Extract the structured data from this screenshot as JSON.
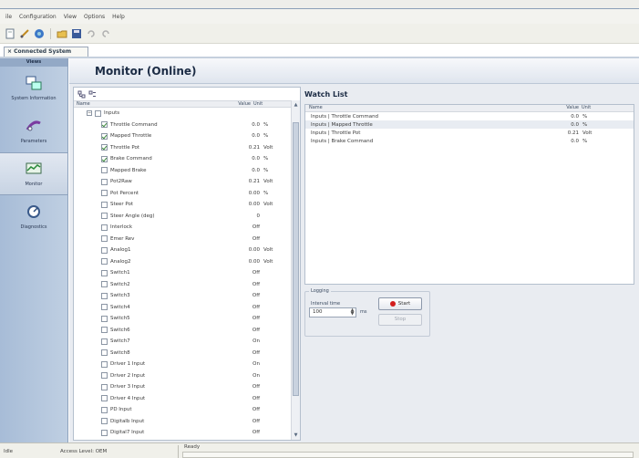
{
  "menu": [
    "ile",
    "Configuration",
    "View",
    "Options",
    "Help"
  ],
  "toolbar_icons": [
    "new-icon",
    "edit-icon",
    "connect-icon",
    "open-icon",
    "save-icon",
    "undo-icon",
    "redo-icon"
  ],
  "tab": {
    "label": "Connected System"
  },
  "nav": {
    "header": "Views",
    "items": [
      {
        "label": "System Information",
        "icon": "system-info-icon"
      },
      {
        "label": "Parameters",
        "icon": "parameters-icon"
      },
      {
        "label": "Monitor",
        "icon": "monitor-icon",
        "active": true
      },
      {
        "label": "Diagnostics",
        "icon": "diagnostics-icon"
      }
    ]
  },
  "page": {
    "title": "Monitor (Online)"
  },
  "grid": {
    "headers": {
      "name": "Name",
      "value": "Value",
      "unit": "Unit"
    },
    "group_label": "Inputs",
    "rows": [
      {
        "name": "Throttle Command",
        "value": "0.0",
        "unit": "%",
        "checked": true
      },
      {
        "name": "Mapped Throttle",
        "value": "0.0",
        "unit": "%",
        "checked": true
      },
      {
        "name": "Throttle Pot",
        "value": "0.21",
        "unit": "Volt",
        "checked": true
      },
      {
        "name": "Brake Command",
        "value": "0.0",
        "unit": "%",
        "checked": true
      },
      {
        "name": "Mapped Brake",
        "value": "0.0",
        "unit": "%",
        "checked": false
      },
      {
        "name": "Pot2Raw",
        "value": "0.21",
        "unit": "Volt",
        "checked": false
      },
      {
        "name": "Pot Percent",
        "value": "0.00",
        "unit": "%",
        "checked": false
      },
      {
        "name": "Steer Pot",
        "value": "0.00",
        "unit": "Volt",
        "checked": false
      },
      {
        "name": "Steer Angle (deg)",
        "value": "0",
        "unit": "",
        "checked": false
      },
      {
        "name": "Interlock",
        "value": "Off",
        "unit": "",
        "checked": false
      },
      {
        "name": "Emer Rev",
        "value": "Off",
        "unit": "",
        "checked": false
      },
      {
        "name": "Analog1",
        "value": "0.00",
        "unit": "Volt",
        "checked": false
      },
      {
        "name": "Analog2",
        "value": "0.00",
        "unit": "Volt",
        "checked": false
      },
      {
        "name": "Switch1",
        "value": "Off",
        "unit": "",
        "checked": false
      },
      {
        "name": "Switch2",
        "value": "Off",
        "unit": "",
        "checked": false
      },
      {
        "name": "Switch3",
        "value": "Off",
        "unit": "",
        "checked": false
      },
      {
        "name": "Switch4",
        "value": "Off",
        "unit": "",
        "checked": false
      },
      {
        "name": "Switch5",
        "value": "Off",
        "unit": "",
        "checked": false
      },
      {
        "name": "Switch6",
        "value": "Off",
        "unit": "",
        "checked": false
      },
      {
        "name": "Switch7",
        "value": "On",
        "unit": "",
        "checked": false
      },
      {
        "name": "Switch8",
        "value": "Off",
        "unit": "",
        "checked": false
      },
      {
        "name": "Driver 1 Input",
        "value": "On",
        "unit": "",
        "checked": false
      },
      {
        "name": "Driver 2 Input",
        "value": "On",
        "unit": "",
        "checked": false
      },
      {
        "name": "Driver 3 Input",
        "value": "Off",
        "unit": "",
        "checked": false
      },
      {
        "name": "Driver 4 Input",
        "value": "Off",
        "unit": "",
        "checked": false
      },
      {
        "name": "PD Input",
        "value": "Off",
        "unit": "",
        "checked": false
      },
      {
        "name": "Digitalb Input",
        "value": "Off",
        "unit": "",
        "checked": false
      },
      {
        "name": "Digital7 Input",
        "value": "Off",
        "unit": "",
        "checked": false
      }
    ]
  },
  "watch": {
    "title": "Watch List",
    "headers": {
      "name": "Name",
      "value": "Value",
      "unit": "Unit"
    },
    "rows": [
      {
        "name": "Inputs | Throttle Command",
        "value": "0.0",
        "unit": "%"
      },
      {
        "name": "Inputs | Mapped Throttle",
        "value": "0.0",
        "unit": "%"
      },
      {
        "name": "Inputs | Throttle Pot",
        "value": "0.21",
        "unit": "Volt"
      },
      {
        "name": "Inputs | Brake Command",
        "value": "0.0",
        "unit": "%"
      }
    ]
  },
  "logging": {
    "title": "Logging",
    "interval_label": "Interval time",
    "interval_value": "100",
    "interval_unit": "ms",
    "start_label": "Start",
    "stop_label": "Stop"
  },
  "status": {
    "left": "Idle",
    "access": "Access Level: OEM",
    "ready": "Ready"
  },
  "colors": {
    "nav_bg": "#a7bcd7",
    "record": "#d21e1e",
    "header_bg": "#dfe5ee"
  }
}
